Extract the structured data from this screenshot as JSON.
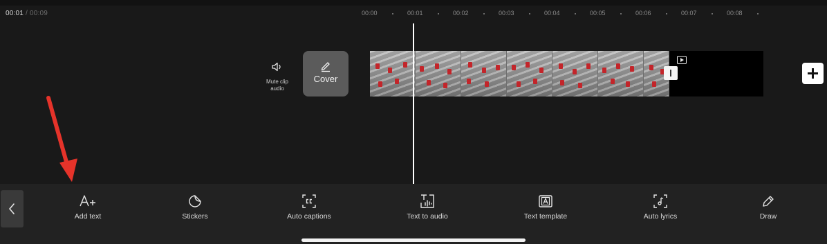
{
  "timecode": {
    "current": "00:01",
    "separator": "/",
    "total": "00:09"
  },
  "ruler": {
    "labels": [
      "00:00",
      "00:01",
      "00:02",
      "00:03",
      "00:04",
      "00:05",
      "00:06",
      "00:07",
      "00:08"
    ]
  },
  "track": {
    "mute_label": "Mute clip audio",
    "cover_label": "Cover",
    "mute_icon": "speaker-icon",
    "cover_icon": "edit-pencil-icon"
  },
  "toolbar": {
    "back_icon": "chevron-left-icon",
    "items": [
      {
        "label": "Add text",
        "icon": "add-text-icon"
      },
      {
        "label": "Stickers",
        "icon": "sticker-icon"
      },
      {
        "label": "Auto captions",
        "icon": "captions-icon"
      },
      {
        "label": "Text to audio",
        "icon": "text-to-audio-icon"
      },
      {
        "label": "Text template",
        "icon": "text-template-icon"
      },
      {
        "label": "Auto lyrics",
        "icon": "lyrics-icon"
      },
      {
        "label": "Draw",
        "icon": "pencil-icon"
      }
    ]
  },
  "colors": {
    "background": "#191919",
    "toolbar": "#222222",
    "playhead": "#ffffff",
    "annotation_arrow": "#e5332a"
  }
}
